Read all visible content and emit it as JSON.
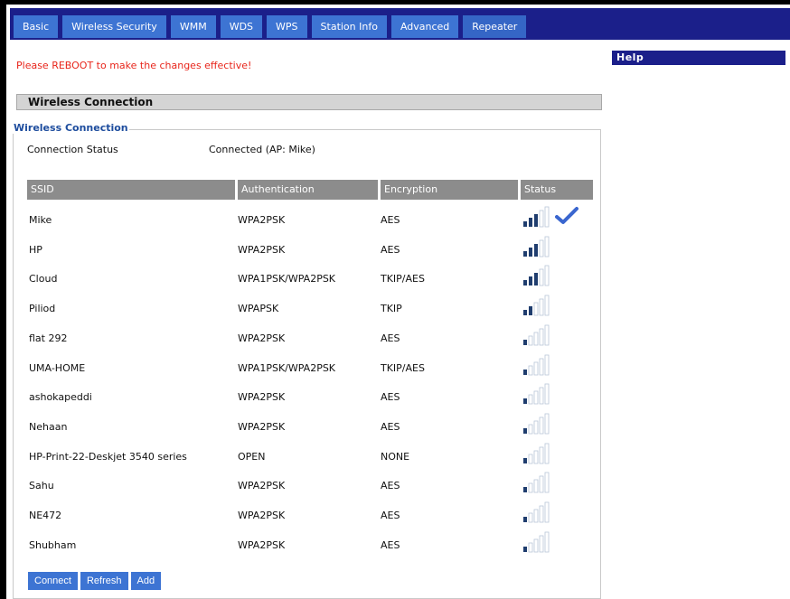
{
  "tabs": [
    {
      "label": "Basic"
    },
    {
      "label": "Wireless Security"
    },
    {
      "label": "WMM"
    },
    {
      "label": "WDS"
    },
    {
      "label": "WPS"
    },
    {
      "label": "Station Info"
    },
    {
      "label": "Advanced"
    },
    {
      "label": "Repeater",
      "active": true
    }
  ],
  "notice": "Please REBOOT to make the changes effective!",
  "help_title": "Help",
  "section_title": "Wireless Connection",
  "fieldset_legend": "Wireless Connection",
  "connection_status": {
    "label": "Connection Status",
    "value": "Connected (AP: Mike)"
  },
  "table": {
    "headers": {
      "ssid": "SSID",
      "auth": "Authentication",
      "enc": "Encryption",
      "status": "Status"
    },
    "rows": [
      {
        "ssid": "Mike",
        "auth": "WPA2PSK",
        "enc": "AES",
        "bars": 3,
        "connected": true
      },
      {
        "ssid": "HP",
        "auth": "WPA2PSK",
        "enc": "AES",
        "bars": 3,
        "connected": false
      },
      {
        "ssid": "Cloud",
        "auth": "WPA1PSK/WPA2PSK",
        "enc": "TKIP/AES",
        "bars": 3,
        "connected": false
      },
      {
        "ssid": "Piliod",
        "auth": "WPAPSK",
        "enc": "TKIP",
        "bars": 2,
        "connected": false
      },
      {
        "ssid": "flat 292",
        "auth": "WPA2PSK",
        "enc": "AES",
        "bars": 1,
        "connected": false
      },
      {
        "ssid": "UMA-HOME",
        "auth": "WPA1PSK/WPA2PSK",
        "enc": "TKIP/AES",
        "bars": 1,
        "connected": false
      },
      {
        "ssid": "ashokapeddi",
        "auth": "WPA2PSK",
        "enc": "AES",
        "bars": 1,
        "connected": false
      },
      {
        "ssid": "Nehaan",
        "auth": "WPA2PSK",
        "enc": "AES",
        "bars": 1,
        "connected": false
      },
      {
        "ssid": "HP-Print-22-Deskjet 3540 series",
        "auth": "OPEN",
        "enc": "NONE",
        "bars": 1,
        "connected": false
      },
      {
        "ssid": "Sahu",
        "auth": "WPA2PSK",
        "enc": "AES",
        "bars": 1,
        "connected": false
      },
      {
        "ssid": "NE472",
        "auth": "WPA2PSK",
        "enc": "AES",
        "bars": 1,
        "connected": false
      },
      {
        "ssid": "Shubham",
        "auth": "WPA2PSK",
        "enc": "AES",
        "bars": 1,
        "connected": false
      }
    ]
  },
  "buttons": {
    "connect": "Connect",
    "refresh": "Refresh",
    "add": "Add"
  },
  "colors": {
    "nav": "#1b1f8a",
    "tab": "#3d74d3",
    "notice": "#e8251b",
    "legend": "#1e4d9e",
    "check": "#3a66cf"
  }
}
